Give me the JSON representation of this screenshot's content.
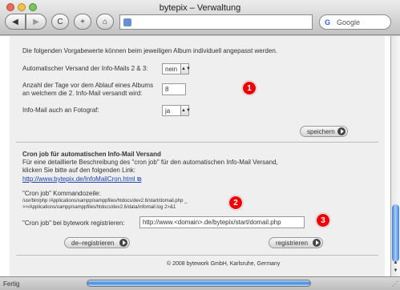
{
  "window": {
    "title": "bytepix – Verwaltung"
  },
  "toolbar": {
    "back": "◀",
    "forward": "▶",
    "reload": "C",
    "plus": "+",
    "home": "⌂"
  },
  "search": {
    "placeholder": "Google",
    "engine_icon": "G"
  },
  "intro": "Die folgenden Vorgabewerte können beim jeweiligen Album individuell angepasst werden.",
  "settings": {
    "auto_send_label": "Automatischer Versand der Info-Mails 2 & 3:",
    "auto_send_value": "nein",
    "days_label_1": "Anzahl der Tage vor dem Ablauf eines Albums",
    "days_label_2": "an welchem die 2. Info-Mail versandt wird:",
    "days_value": "8",
    "photographer_label": "Info-Mail auch an Fotograf:",
    "photographer_value": "ja",
    "save_button": "speichern"
  },
  "cron": {
    "heading": "Cron job für automatischen Info-Mail Versand",
    "desc_1": "Für eine detaillierte Beschreibung des \"cron job\" für den automatischen Info-Mail Versand,",
    "desc_2": "klicken Sie bitte auf den folgenden Link:",
    "link": "http://www.bytepix.de/InfoMailCron.html",
    "command_label": "\"Cron job\" Kommandozeile:",
    "command_1": "/usr/bin/php /Applications/xampp/xamppfiles/htdocs/dev2.6/start/domail.php _",
    "command_2": ">>/Applications/xampp/xamppfiles/htdocs/dev2.6/data/infomail.log 2>&1",
    "register_label": "\"Cron job\" bei bytework registrieren:",
    "register_value": "http://www.<domain>.de/bytepix/start/domail.php",
    "deregister_button": "de–registrieren",
    "register_button": "registrieren"
  },
  "footer": "© 2008 bytework GmbH, Karlsruhe, Germany",
  "badges": [
    "1",
    "2",
    "3"
  ],
  "status": {
    "text": "Fertig"
  },
  "colors": {
    "badge": "#e00000",
    "link": "#1a3fb0",
    "progress": "#3d86dd"
  }
}
